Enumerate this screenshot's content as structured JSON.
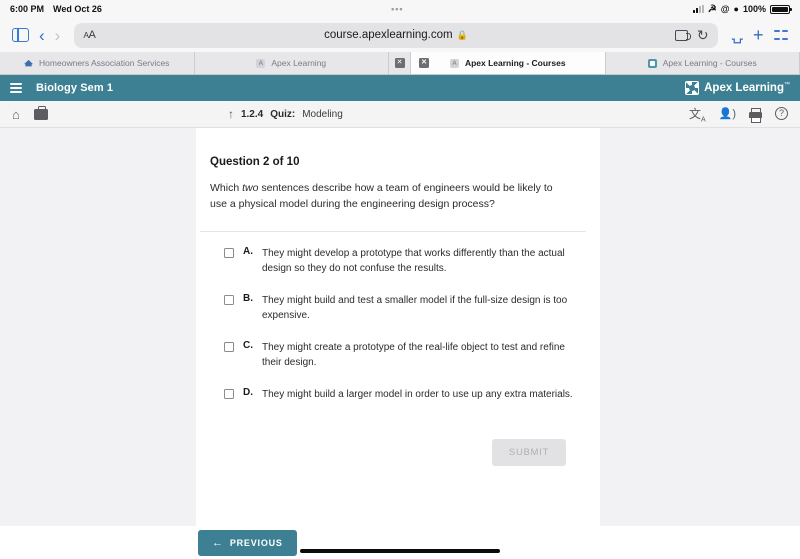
{
  "status_bar": {
    "time": "6:00 PM",
    "date": "Wed Oct 26",
    "dots": "•••",
    "at_symbol": "@",
    "person_icon": "person-icon",
    "battery_percent": "100%"
  },
  "browser": {
    "sidebar_icon": "sidebar-toggle-icon",
    "back_icon": "‹",
    "forward_icon": "›",
    "text_size_label": "A",
    "text_size_label_small": "A",
    "url": "course.apexlearning.com",
    "lock_icon": "🔒",
    "reload_icon": "↻",
    "share_icon": "⇧",
    "new_tab_icon": "+",
    "tabs_overview_icon": "tab-overview-icon",
    "tabs": [
      {
        "title": "Homeowners Association Services",
        "active": false,
        "favicon": "hoa-house-icon",
        "closable": false
      },
      {
        "title": "Apex Learning",
        "active": false,
        "favicon": "apex-gray-icon",
        "closable": true
      },
      {
        "title": "Apex Learning - Courses",
        "active": true,
        "favicon": "apex-gray-icon",
        "closable": true
      },
      {
        "title": "Apex Learning - Courses",
        "active": false,
        "favicon": "apex-teal-icon",
        "closable": false
      }
    ],
    "close_glyph": "✕"
  },
  "app_header": {
    "menu_icon": "hamburger-menu-icon",
    "course_title": "Biology Sem 1",
    "brand_name": "Apex Learning",
    "brand_tm": "™"
  },
  "breadcrumb": {
    "home_icon": "⌂",
    "briefcase_icon": "briefcase-icon",
    "up_arrow": "↑",
    "activity_number": "1.2.4",
    "activity_type": "Quiz:",
    "activity_name": "Modeling",
    "translate_icon": "translate-icon",
    "read_aloud_icon": "read-aloud-icon",
    "print_icon": "print-icon",
    "help_icon": "?"
  },
  "quiz": {
    "question_counter": "Question 2 of 10",
    "question_prefix": "Which ",
    "question_emphasis": "two",
    "question_suffix": " sentences describe how a team of engineers would be likely to use a physical model during the engineering design process?",
    "options": [
      {
        "letter": "A.",
        "text": "They might develop a prototype that works differently than the actual design so they do not confuse the results.",
        "checked": false
      },
      {
        "letter": "B.",
        "text": "They might build and test a smaller model if the full-size design is too expensive.",
        "checked": false
      },
      {
        "letter": "C.",
        "text": "They might create a prototype of the real-life object to test and refine their design.",
        "checked": false
      },
      {
        "letter": "D.",
        "text": "They might build a larger model in order to use up any extra materials.",
        "checked": false
      }
    ],
    "submit_label": "SUBMIT",
    "submit_disabled": true
  },
  "footer": {
    "previous_arrow": "←",
    "previous_label": "PREVIOUS"
  },
  "colors": {
    "teal": "#3d8093",
    "safari_blue": "#2f6fc4",
    "page_bg": "#f2f2f4"
  }
}
